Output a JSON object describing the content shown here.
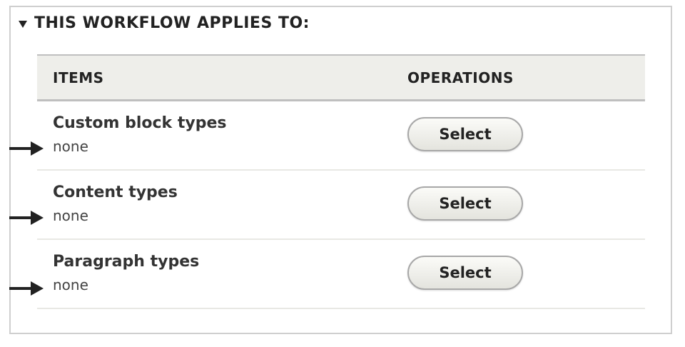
{
  "fieldset": {
    "legend": "THIS WORKFLOW APPLIES TO:"
  },
  "table": {
    "headers": {
      "items": "ITEMS",
      "operations": "OPERATIONS"
    },
    "rows": [
      {
        "title": "Custom block types",
        "value": "none",
        "button": "Select"
      },
      {
        "title": "Content types",
        "value": "none",
        "button": "Select"
      },
      {
        "title": "Paragraph types",
        "value": "none",
        "button": "Select"
      }
    ]
  },
  "icons": {
    "legend_toggle": "triangle-down-icon",
    "row_marker": "arrow-right-icon"
  },
  "colors": {
    "header_bg": "#eeeeea",
    "border": "#cfcfcf",
    "text": "#333333"
  }
}
